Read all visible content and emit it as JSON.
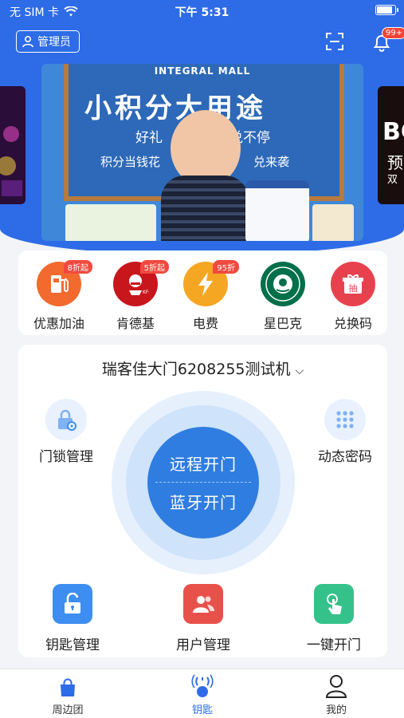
{
  "status_bar": {
    "carrier": "无 SIM 卡",
    "time": "下午 5:31",
    "battery_level": 0.9
  },
  "topbar": {
    "admin_label": "管理员",
    "notification_badge": "99+"
  },
  "banner": {
    "brand": "INTEGRAL MALL",
    "title": "小积分大用途",
    "line1": "好礼",
    "line2": "兑不停",
    "line3": "积分当钱花",
    "line4": "兑来袭",
    "side_right_text": "BC",
    "side_right_sub": "预",
    "side_right_sub2": "双"
  },
  "services": [
    {
      "label": "优惠加油",
      "tag": "8折起",
      "color": "#f26a2e",
      "icon": "fuel-pump-icon"
    },
    {
      "label": "肯德基",
      "tag": "5折起",
      "color": "#c8161d",
      "icon": "kfc-logo-icon"
    },
    {
      "label": "电费",
      "tag": "95折",
      "color": "#f5a623",
      "icon": "lightning-icon"
    },
    {
      "label": "星巴克",
      "tag": "",
      "color": "#00704a",
      "icon": "starbucks-logo-icon"
    },
    {
      "label": "兑换码",
      "tag": "",
      "color": "#e8414e",
      "icon": "gift-icon",
      "icon_text": "抽"
    }
  ],
  "door": {
    "device_name": "瑞客佳大门6208255测试机",
    "lock_manage": "门锁管理",
    "dynamic_password": "动态密码",
    "remote_open": "远程开门",
    "bluetooth_open": "蓝牙开门"
  },
  "tools": [
    {
      "label": "钥匙管理",
      "color": "#3d8ef0",
      "icon": "unlock-icon"
    },
    {
      "label": "用户管理",
      "color": "#e8514a",
      "icon": "users-icon"
    },
    {
      "label": "一键开门",
      "color": "#35c28a",
      "icon": "tap-hand-icon"
    }
  ],
  "tabs": [
    {
      "label": "周边团",
      "icon": "shopping-bag-icon",
      "active": false
    },
    {
      "label": "钥匙",
      "icon": "key-signal-icon",
      "active": true
    },
    {
      "label": "我的",
      "icon": "person-icon",
      "active": false
    }
  ],
  "colors": {
    "primary": "#2e6be6",
    "background": "#f2f4f7"
  }
}
